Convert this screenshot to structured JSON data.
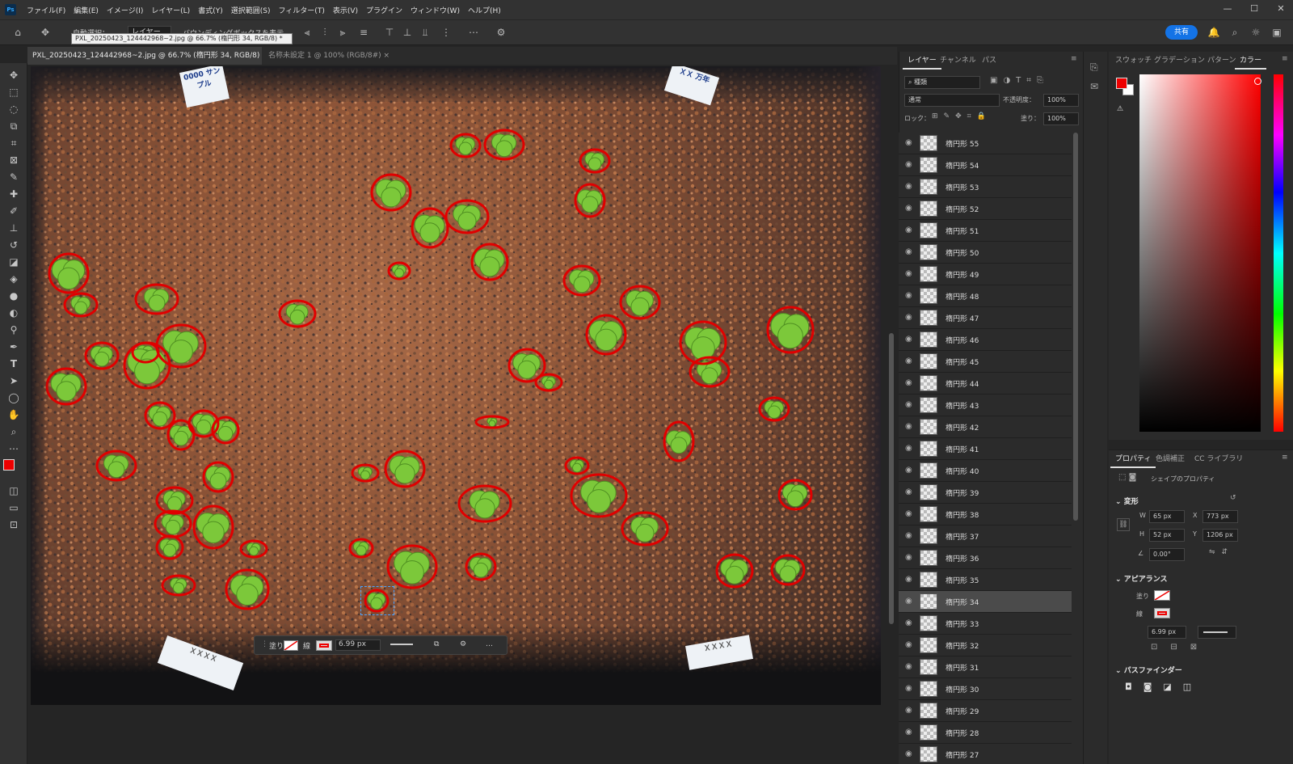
{
  "app": {
    "logo": "Ps"
  },
  "menubar": {
    "items": [
      "ファイル(F)",
      "編集(E)",
      "イメージ(I)",
      "レイヤー(L)",
      "書式(Y)",
      "選択範囲(S)",
      "フィルター(T)",
      "表示(V)",
      "プラグイン",
      "ウィンドウ(W)",
      "ヘルプ(H)"
    ]
  },
  "optionsbar": {
    "auto_select_label": "自動選択：",
    "auto_select_value": "レイヤー",
    "bounding_box_label": "バウンディングボックスを表示",
    "share_label": "共有"
  },
  "tooltip": "PXL_20250423_124442968~2.jpg @ 66.7% (楕円形 34, RGB/8) *",
  "doc_tabs": [
    {
      "label": "PXL_20250423_124442968~2.jpg @ 66.7% (楕円形 34, RGB/8) *",
      "close": "×",
      "active": true
    },
    {
      "label": "名称未設定 1 @ 100% (RGB/8#)",
      "close": "×",
      "active": false
    }
  ],
  "canvas": {
    "tags": [
      "0000 サンプル",
      "ＸＸ 万年",
      "ＸＸＸＸ",
      "ＸＸＸＸ"
    ]
  },
  "float_toolbar": {
    "fill_label": "塗り",
    "stroke_label": "線",
    "stroke_width": "6.99 px",
    "more": "…"
  },
  "layers_panel": {
    "tabs": [
      "レイヤー",
      "チャンネル",
      "パス"
    ],
    "filter_label": "種類",
    "blend_mode": "通常",
    "opacity_label": "不透明度：",
    "opacity_value": "100%",
    "lock_label": "ロック：",
    "fill_label": "塗り：",
    "fill_value": "100%",
    "layers": [
      "楕円形 55",
      "楕円形 54",
      "楕円形 53",
      "楕円形 52",
      "楕円形 51",
      "楕円形 50",
      "楕円形 49",
      "楕円形 48",
      "楕円形 47",
      "楕円形 46",
      "楕円形 45",
      "楕円形 44",
      "楕円形 43",
      "楕円形 42",
      "楕円形 41",
      "楕円形 40",
      "楕円形 39",
      "楕円形 38",
      "楕円形 37",
      "楕円形 36",
      "楕円形 35",
      "楕円形 34",
      "楕円形 33",
      "楕円形 32",
      "楕円形 31",
      "楕円形 30",
      "楕円形 29",
      "楕円形 28",
      "楕円形 27"
    ],
    "selected_layer": "楕円形 34"
  },
  "color_panel": {
    "tabs": [
      "スウォッチ",
      "グラデーション",
      "パターン",
      "カラー"
    ],
    "foreground": "#ee0000",
    "background": "#ffffff"
  },
  "properties_panel": {
    "tabs": [
      "プロパティ",
      "色調補正",
      "CC ライブラリ"
    ],
    "shape_props_label": "シェイプのプロパティ",
    "transform_section": "変形",
    "w_label": "W",
    "w_value": "65 px",
    "x_label": "X",
    "x_value": "773 px",
    "h_label": "H",
    "h_value": "52 px",
    "y_label": "Y",
    "y_value": "1206 px",
    "angle_value": "0.00°",
    "appearance_section": "アピアランス",
    "fill_label": "塗り",
    "stroke_label": "線",
    "stroke_width": "6.99 px",
    "pathfinder_section": "パスファインダー"
  },
  "colors": {
    "accent": "#1473e6",
    "circle_stroke": "#e00000",
    "seedling": "#7cc83a"
  }
}
